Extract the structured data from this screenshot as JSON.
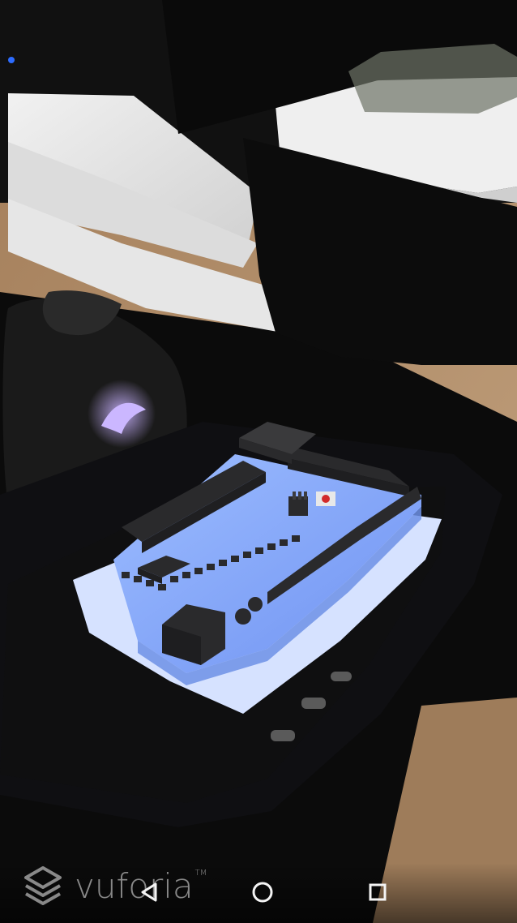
{
  "watermark": {
    "text": "vuforia",
    "tm": "TM"
  },
  "nav": {
    "back_icon": "back-triangle-icon",
    "home_icon": "home-circle-icon",
    "recents_icon": "recents-square-icon"
  },
  "colors": {
    "board": "#8fb3ff",
    "board_shadow": "#6d91e6",
    "screen": "#d6e2ff",
    "desk": "#c6a07a",
    "component": "#2a2a2c",
    "button_red": "#d22a2a"
  }
}
